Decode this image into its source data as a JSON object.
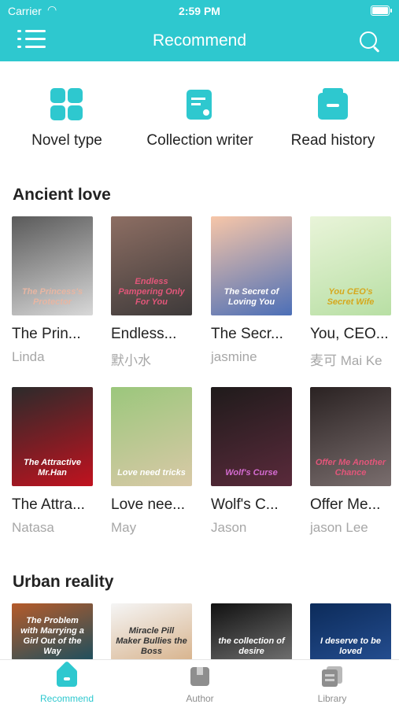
{
  "status_bar": {
    "carrier": "Carrier",
    "time": "2:59 PM"
  },
  "nav": {
    "title": "Recommend"
  },
  "quick_actions": [
    {
      "label": "Novel type",
      "icon": "grid-icon"
    },
    {
      "label": "Collection writer",
      "icon": "collection-icon"
    },
    {
      "label": "Read history",
      "icon": "history-icon"
    }
  ],
  "sections": [
    {
      "title": "Ancient love",
      "books": [
        {
          "title": "The Prin...",
          "author": "Linda",
          "cover_text": "The Princess's Protector",
          "cover_colors": [
            "#5a5a5a",
            "#d8d8d8"
          ],
          "text_color": "#e7b6a3"
        },
        {
          "title": "Endless...",
          "author": "默小水",
          "cover_text": "Endless Pampering Only For You",
          "cover_colors": [
            "#8d6e63",
            "#3e3a3a"
          ],
          "text_color": "#e2567a"
        },
        {
          "title": "The Secr...",
          "author": "jasmine",
          "cover_text": "The Secret of Loving You",
          "cover_colors": [
            "#f7c6a8",
            "#4c6fb7"
          ],
          "text_color": "#ffffff"
        },
        {
          "title": "You, CEO...",
          "author": "麦可 Mai Ke",
          "cover_text": "You CEO's Secret Wife",
          "cover_colors": [
            "#e9f4d9",
            "#b8dfa4"
          ],
          "text_color": "#d6a81d"
        }
      ]
    },
    {
      "title": "",
      "books": [
        {
          "title": "The Attra...",
          "author": "Natasa",
          "cover_text": "The Attractive Mr.Han",
          "cover_colors": [
            "#2b2b2b",
            "#c1121f"
          ],
          "text_color": "#ffffff"
        },
        {
          "title": "Love nee...",
          "author": "May",
          "cover_text": "Love need tricks",
          "cover_colors": [
            "#9bc77c",
            "#d9c9a7"
          ],
          "text_color": "#ffffff"
        },
        {
          "title": "Wolf's C...",
          "author": "Jason",
          "cover_text": "Wolf's Curse",
          "cover_colors": [
            "#1f1b1b",
            "#5a2a3b"
          ],
          "text_color": "#d46bd0"
        },
        {
          "title": "Offer Me...",
          "author": "jason Lee",
          "cover_text": "Offer Me Another Chance",
          "cover_colors": [
            "#2a2222",
            "#7a6e6e"
          ],
          "text_color": "#e2567a"
        }
      ]
    },
    {
      "title": "Urban reality",
      "books": [
        {
          "title": "",
          "author": "",
          "cover_text": "The Problem with Marrying a Girl Out of the Way",
          "cover_colors": [
            "#b55b2a",
            "#1f4f5e"
          ],
          "text_color": "#ffffff"
        },
        {
          "title": "",
          "author": "",
          "cover_text": "Miracle Pill Maker Bullies the Boss",
          "cover_colors": [
            "#f5f5f5",
            "#d8b48e"
          ],
          "text_color": "#333333"
        },
        {
          "title": "",
          "author": "",
          "cover_text": "the collection of desire",
          "cover_colors": [
            "#111111",
            "#6e6e6e"
          ],
          "text_color": "#ffffff"
        },
        {
          "title": "",
          "author": "",
          "cover_text": "I deserve to be loved",
          "cover_colors": [
            "#0c2b5a",
            "#244d8f"
          ],
          "text_color": "#ffffff"
        }
      ]
    }
  ],
  "tabbar": [
    {
      "label": "Recommend",
      "icon": "home-icon",
      "active": true
    },
    {
      "label": "Author",
      "icon": "author-icon",
      "active": false
    },
    {
      "label": "Library",
      "icon": "library-icon",
      "active": false
    }
  ],
  "colors": {
    "accent": "#2ec8cf",
    "muted": "#a7a7a7"
  }
}
